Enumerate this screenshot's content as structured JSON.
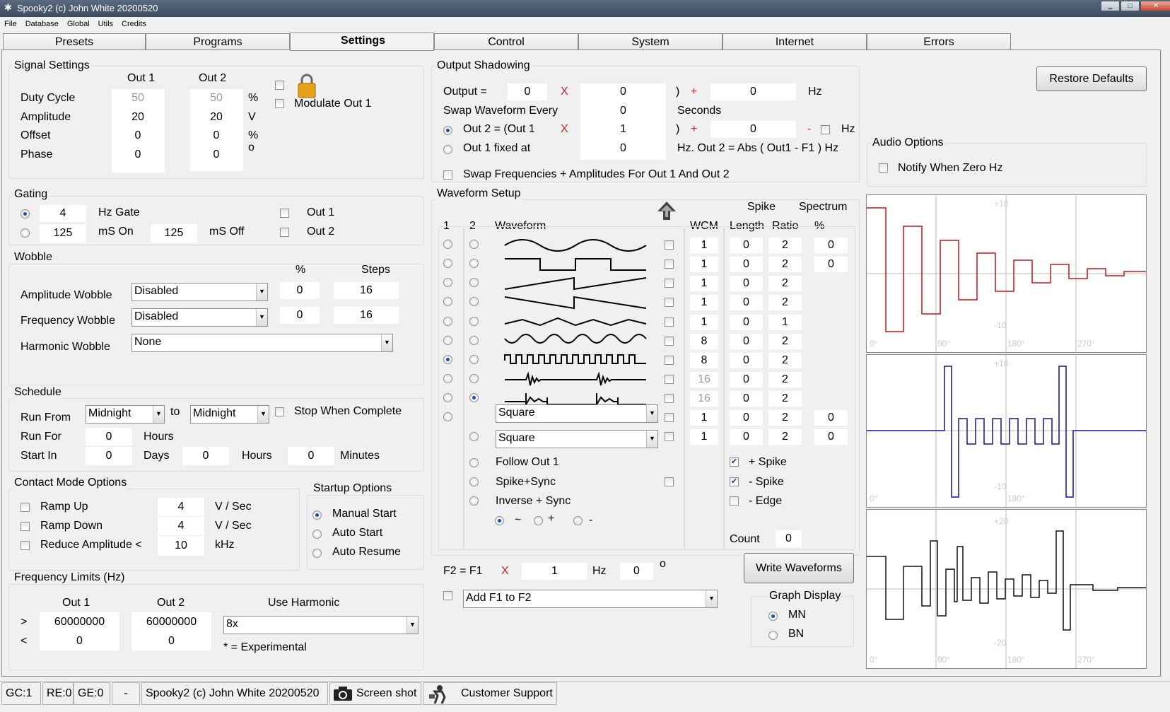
{
  "window": {
    "title": "Spooky2 (c) John White 20200520",
    "btn_min": "‗",
    "btn_max": "□",
    "btn_close": "✕"
  },
  "menu": [
    "File",
    "Database",
    "Global",
    "Utils",
    "Credits"
  ],
  "tabs": [
    "Presets",
    "Programs",
    "Settings",
    "Control",
    "System",
    "Internet",
    "Errors"
  ],
  "signal": {
    "title": "Signal Settings",
    "col1": "Out 1",
    "col2": "Out 2",
    "rows": [
      {
        "label": "Duty Cycle",
        "o1": "50",
        "o2": "50",
        "unit": "%"
      },
      {
        "label": "Amplitude",
        "o1": "20",
        "o2": "20",
        "unit": "V"
      },
      {
        "label": "Offset",
        "o1": "0",
        "o2": "0",
        "unit": "%"
      },
      {
        "label": "Phase",
        "o1": "0",
        "o2": "0",
        "unit": "o"
      }
    ],
    "modulate": "Modulate Out 1"
  },
  "gating": {
    "title": "Gating",
    "hz_val": "4",
    "hz_label": "Hz Gate",
    "on_val": "125",
    "on_label": "mS On",
    "off_val": "125",
    "off_label": "mS Off",
    "out1": "Out 1",
    "out2": "Out 2"
  },
  "wobble": {
    "title": "Wobble",
    "pct": "%",
    "steps": "Steps",
    "amp": {
      "label": "Amplitude Wobble",
      "value": "Disabled",
      "pct": "0",
      "steps": "16"
    },
    "freq": {
      "label": "Frequency Wobble",
      "value": "Disabled",
      "pct": "0",
      "steps": "16"
    },
    "harm": {
      "label": "Harmonic Wobble",
      "value": "None"
    }
  },
  "schedule": {
    "title": "Schedule",
    "run_from": "Run From",
    "from_val": "Midnight",
    "to": "to",
    "to_val": "Midnight",
    "stop": "Stop When Complete",
    "run_for": "Run For",
    "run_for_val": "0",
    "hours": "Hours",
    "start_in": "Start In",
    "start_days_val": "0",
    "days": "Days",
    "start_hours_val": "0",
    "hours2": "Hours",
    "start_min_val": "0",
    "minutes": "Minutes"
  },
  "contact": {
    "title": "Contact Mode Options",
    "ramp_up": "Ramp Up",
    "ramp_up_val": "4",
    "ramp_up_unit": "V / Sec",
    "ramp_down": "Ramp Down",
    "ramp_down_val": "4",
    "ramp_down_unit": "V / Sec",
    "reduce": "Reduce Amplitude <",
    "reduce_val": "10",
    "reduce_unit": "kHz"
  },
  "startup": {
    "title": "Startup Options",
    "manual": "Manual Start",
    "auto": "Auto Start",
    "resume": "Auto Resume"
  },
  "freq_limits": {
    "title": "Frequency Limits (Hz)",
    "out1": "Out 1",
    "out2": "Out 2",
    "use_harm": "Use Harmonic",
    "gt": ">",
    "lt": "<",
    "max1": "60000000",
    "max2": "60000000",
    "min1": "0",
    "min2": "0",
    "harm_val": "8x",
    "experimental": "* = Experimental"
  },
  "shadow": {
    "title": "Output Shadowing",
    "output_eq": "Output =",
    "out_v1": "0",
    "x": "X",
    "out_v2": "0",
    "paren": ")",
    "plus": "+",
    "out_v3": "0",
    "hz": "Hz",
    "swap_every": "Swap Waveform Every",
    "swap_val": "0",
    "seconds": "Seconds",
    "out2_eq": "Out 2 = (Out 1",
    "o2_v1": "1",
    "o2_v2": "0",
    "minus": "-",
    "hz2": "Hz",
    "fixed": "Out 1 fixed at",
    "fixed_val": "0",
    "abs": "Hz. Out 2 = Abs ( Out1 - F1 ) Hz",
    "swap_freq": "Swap Frequencies + Amplitudes For Out 1 And Out 2"
  },
  "wave": {
    "title": "Waveform Setup",
    "c1": "1",
    "c2": "2",
    "waveform": "Waveform",
    "wcm": "WCM",
    "spike": "Spike",
    "length": "Length",
    "ratio": "Ratio",
    "spectrum": "Spectrum",
    "pct": "%",
    "rows": [
      {
        "wcm": "1",
        "len": "0",
        "ratio": "2",
        "spec": "0"
      },
      {
        "wcm": "1",
        "len": "0",
        "ratio": "2",
        "spec": "0"
      },
      {
        "wcm": "1",
        "len": "0",
        "ratio": "2",
        "spec": ""
      },
      {
        "wcm": "1",
        "len": "0",
        "ratio": "2",
        "spec": ""
      },
      {
        "wcm": "1",
        "len": "0",
        "ratio": "1",
        "spec": ""
      },
      {
        "wcm": "8",
        "len": "0",
        "ratio": "2",
        "spec": ""
      },
      {
        "wcm": "8",
        "len": "0",
        "ratio": "2",
        "spec": ""
      },
      {
        "wcm": "16",
        "len": "0",
        "ratio": "2",
        "spec": ""
      },
      {
        "wcm": "16",
        "len": "0",
        "ratio": "2",
        "spec": ""
      },
      {
        "wcm": "1",
        "len": "0",
        "ratio": "2",
        "spec": "0"
      },
      {
        "wcm": "1",
        "len": "0",
        "ratio": "2",
        "spec": "0"
      }
    ],
    "sel1": "Square",
    "sel2": "Square",
    "follow": "Follow Out 1",
    "spike_sync": "Spike+Sync",
    "inverse": "Inverse + Sync",
    "tilde": "~",
    "plus": "+",
    "minus": "-",
    "pspike": "+ Spike",
    "mspike": "- Spike",
    "edge": "- Edge",
    "count": "Count",
    "count_val": "0",
    "f2": "F2 = F1",
    "x": "X",
    "f2_mult": "1",
    "hz": "Hz",
    "f2_phase": "0",
    "deg": "o",
    "add": "Add F1 to F2",
    "write": "Write Waveforms"
  },
  "graph_display": {
    "title": "Graph Display",
    "mn": "MN",
    "bn": "BN"
  },
  "right": {
    "restore": "Restore Defaults",
    "audio": "Audio Options",
    "notify": "Notify When Zero Hz"
  },
  "graphs": {
    "g1_top": "+10",
    "g1_bot": "-10",
    "g2_top": "+10",
    "g2_bot": "-10",
    "g3_top": "+20",
    "g3_bot": "-20",
    "t0": "0°",
    "t90": "90°",
    "t180": "180°",
    "t270": "270°"
  },
  "status": {
    "gc": "GC:1",
    "re": "RE:0",
    "ge": "GE:0",
    "dash": "-",
    "title": "Spooky2 (c) John White 20200520",
    "screenshot": "Screen shot",
    "support": "Customer Support"
  }
}
